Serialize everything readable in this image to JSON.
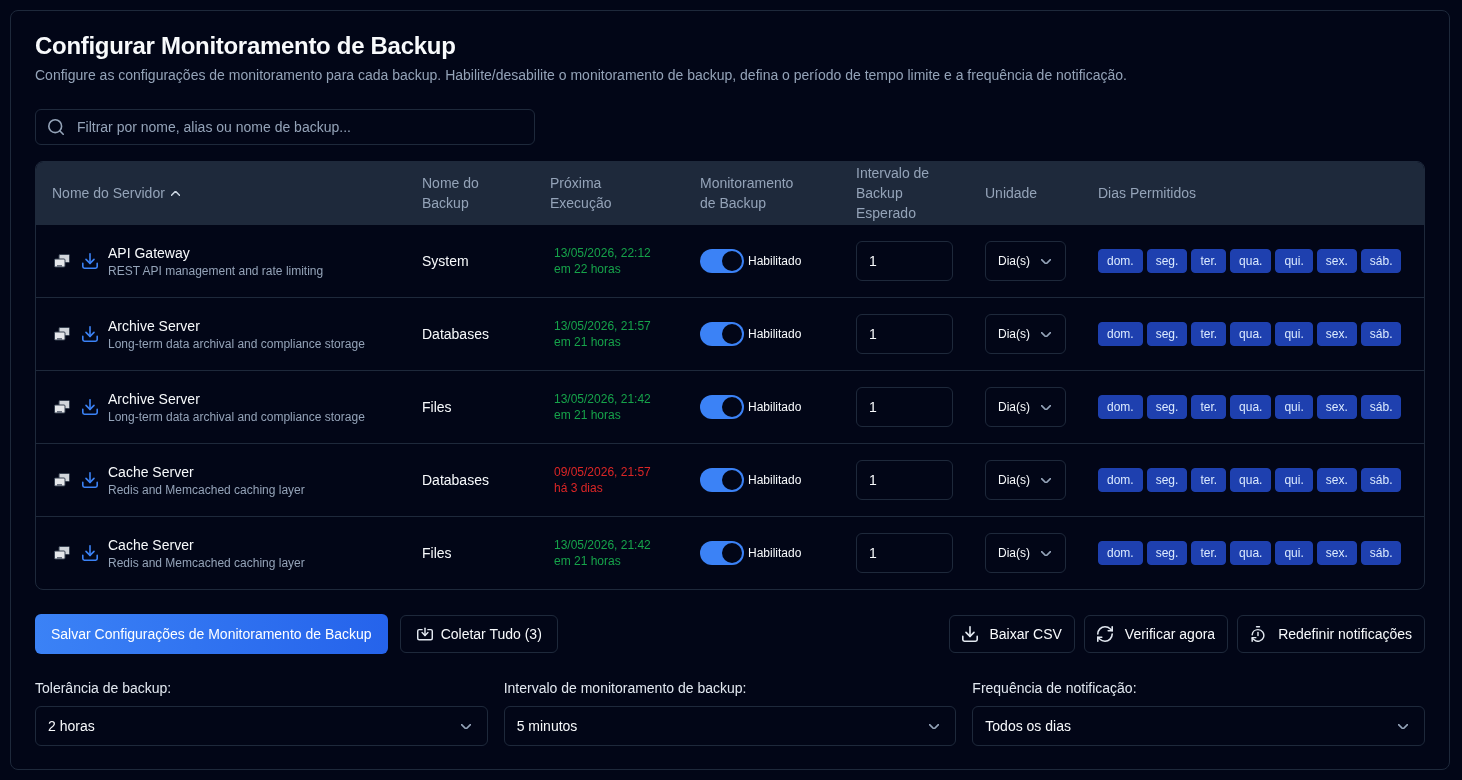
{
  "header": {
    "title": "Configurar Monitoramento de Backup",
    "subtitle": "Configure as configurações de monitoramento para cada backup. Habilite/desabilite o monitoramento de backup, defina o período de tempo limite e a frequência de notificação."
  },
  "search": {
    "placeholder": "Filtrar por nome, alias ou nome de backup..."
  },
  "table": {
    "columns": [
      {
        "label": "Nome do Servidor",
        "sorted": true
      },
      {
        "label": "Nome do Backup",
        "sorted": false
      },
      {
        "label": "Próxima Execução",
        "sorted": false
      },
      {
        "label": "Monitoramento de Backup",
        "sorted": false
      },
      {
        "label": "Intervalo de Backup Esperado",
        "sorted": false
      },
      {
        "label": "Unidade",
        "sorted": false
      },
      {
        "label": "Dias Permitidos",
        "sorted": false
      }
    ],
    "rows": [
      {
        "server": "API Gateway",
        "description": "REST API management and rate limiting",
        "backup": "System",
        "next_run": "13/05/2026, 22:12",
        "relative": "em 22 horas",
        "overdue": false,
        "monitoring": {
          "on": true,
          "label": "Habilitado"
        },
        "interval": "1",
        "unit": "Dia(s)",
        "days": [
          {
            "label": "dom.",
            "selected": true
          },
          {
            "label": "seg.",
            "selected": true
          },
          {
            "label": "ter.",
            "selected": true
          },
          {
            "label": "qua.",
            "selected": true
          },
          {
            "label": "qui.",
            "selected": true
          },
          {
            "label": "sex.",
            "selected": true
          },
          {
            "label": "sáb.",
            "selected": true
          }
        ]
      },
      {
        "server": "Archive Server",
        "description": "Long-term data archival and compliance storage",
        "backup": "Databases",
        "next_run": "13/05/2026, 21:57",
        "relative": "em 21 horas",
        "overdue": false,
        "monitoring": {
          "on": true,
          "label": "Habilitado"
        },
        "interval": "1",
        "unit": "Dia(s)",
        "days": [
          {
            "label": "dom.",
            "selected": true
          },
          {
            "label": "seg.",
            "selected": true
          },
          {
            "label": "ter.",
            "selected": true
          },
          {
            "label": "qua.",
            "selected": true
          },
          {
            "label": "qui.",
            "selected": true
          },
          {
            "label": "sex.",
            "selected": true
          },
          {
            "label": "sáb.",
            "selected": true
          }
        ]
      },
      {
        "server": "Archive Server",
        "description": "Long-term data archival and compliance storage",
        "backup": "Files",
        "next_run": "13/05/2026, 21:42",
        "relative": "em 21 horas",
        "overdue": false,
        "monitoring": {
          "on": true,
          "label": "Habilitado"
        },
        "interval": "1",
        "unit": "Dia(s)",
        "days": [
          {
            "label": "dom.",
            "selected": true
          },
          {
            "label": "seg.",
            "selected": true
          },
          {
            "label": "ter.",
            "selected": true
          },
          {
            "label": "qua.",
            "selected": true
          },
          {
            "label": "qui.",
            "selected": true
          },
          {
            "label": "sex.",
            "selected": true
          },
          {
            "label": "sáb.",
            "selected": true
          }
        ]
      },
      {
        "server": "Cache Server",
        "description": "Redis and Memcached caching layer",
        "backup": "Databases",
        "next_run": "09/05/2026, 21:57",
        "relative": "há 3 dias",
        "overdue": true,
        "monitoring": {
          "on": true,
          "label": "Habilitado"
        },
        "interval": "1",
        "unit": "Dia(s)",
        "days": [
          {
            "label": "dom.",
            "selected": true
          },
          {
            "label": "seg.",
            "selected": true
          },
          {
            "label": "ter.",
            "selected": true
          },
          {
            "label": "qua.",
            "selected": true
          },
          {
            "label": "qui.",
            "selected": true
          },
          {
            "label": "sex.",
            "selected": true
          },
          {
            "label": "sáb.",
            "selected": true
          }
        ]
      },
      {
        "server": "Cache Server",
        "description": "Redis and Memcached caching layer",
        "backup": "Files",
        "next_run": "13/05/2026, 21:42",
        "relative": "em 21 horas",
        "overdue": false,
        "monitoring": {
          "on": true,
          "label": "Habilitado"
        },
        "interval": "1",
        "unit": "Dia(s)",
        "days": [
          {
            "label": "dom.",
            "selected": true
          },
          {
            "label": "seg.",
            "selected": true
          },
          {
            "label": "ter.",
            "selected": true
          },
          {
            "label": "qua.",
            "selected": true
          },
          {
            "label": "qui.",
            "selected": true
          },
          {
            "label": "sex.",
            "selected": true
          },
          {
            "label": "sáb.",
            "selected": true
          }
        ]
      }
    ]
  },
  "actions": {
    "left": [
      {
        "label": "Salvar Configurações de Monitoramento de Backup",
        "kind": "primary"
      },
      {
        "label": "Coletar Tudo (3)",
        "kind": "outline"
      }
    ],
    "right": [
      {
        "label": "Baixar CSV",
        "kind": "outline"
      },
      {
        "label": "Verificar agora",
        "kind": "outline"
      },
      {
        "label": "Redefinir notificações",
        "kind": "outline"
      }
    ]
  },
  "settings": [
    {
      "label": "Tolerância de backup:",
      "value": "2 horas"
    },
    {
      "label": "Intervalo de monitoramento de backup:",
      "value": "5 minutos"
    },
    {
      "label": "Frequência de notificação:",
      "value": "Todos os dias"
    }
  ]
}
